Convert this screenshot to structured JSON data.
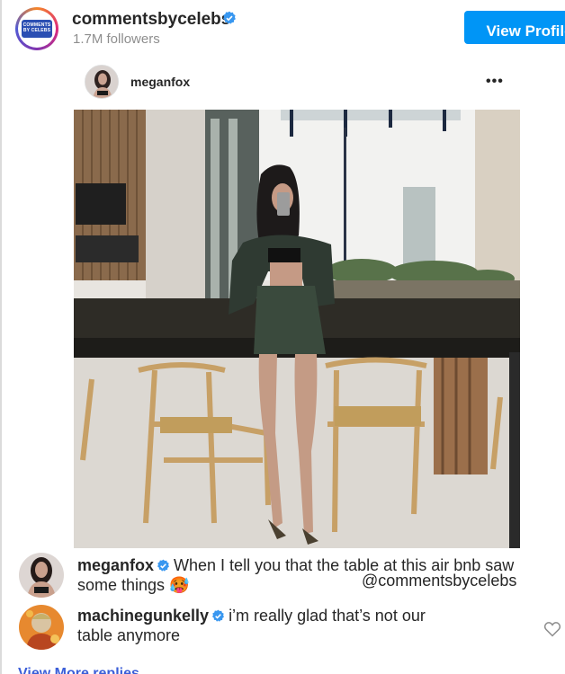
{
  "header": {
    "account_name": "commentsbyceleb s",
    "account": "commentsbycelebs",
    "logo_text": [
      "COMMENTS",
      "BY CELEBS"
    ],
    "followers": "1.7M followers",
    "view_profile_label": "View Profile",
    "verified_icon": "verified-badge-icon"
  },
  "post": {
    "username": "meganfox",
    "more_icon": "more-options-icon",
    "more_label": "•••",
    "image": "photo of a woman taking a mirror selfie in a kitchen with a marble table and wooden wishbone chairs"
  },
  "comments": [
    {
      "username": "meganfox",
      "verified": true,
      "text_line1": "When I tell you that the table at this air bnb saw",
      "text_line2": "some things",
      "emoji": "🥵"
    },
    {
      "username": "machinegunkelly",
      "verified": true,
      "text_line1": "i’m really glad that’s not our",
      "text_line2": "table anymore"
    }
  ],
  "watermark": "@commentsbycelebs",
  "view_more": "View More replies",
  "colors": {
    "accent_blue": "#0095f6",
    "verified_blue": "#3897f0",
    "text": "#262626",
    "muted": "#8e8e8e"
  }
}
